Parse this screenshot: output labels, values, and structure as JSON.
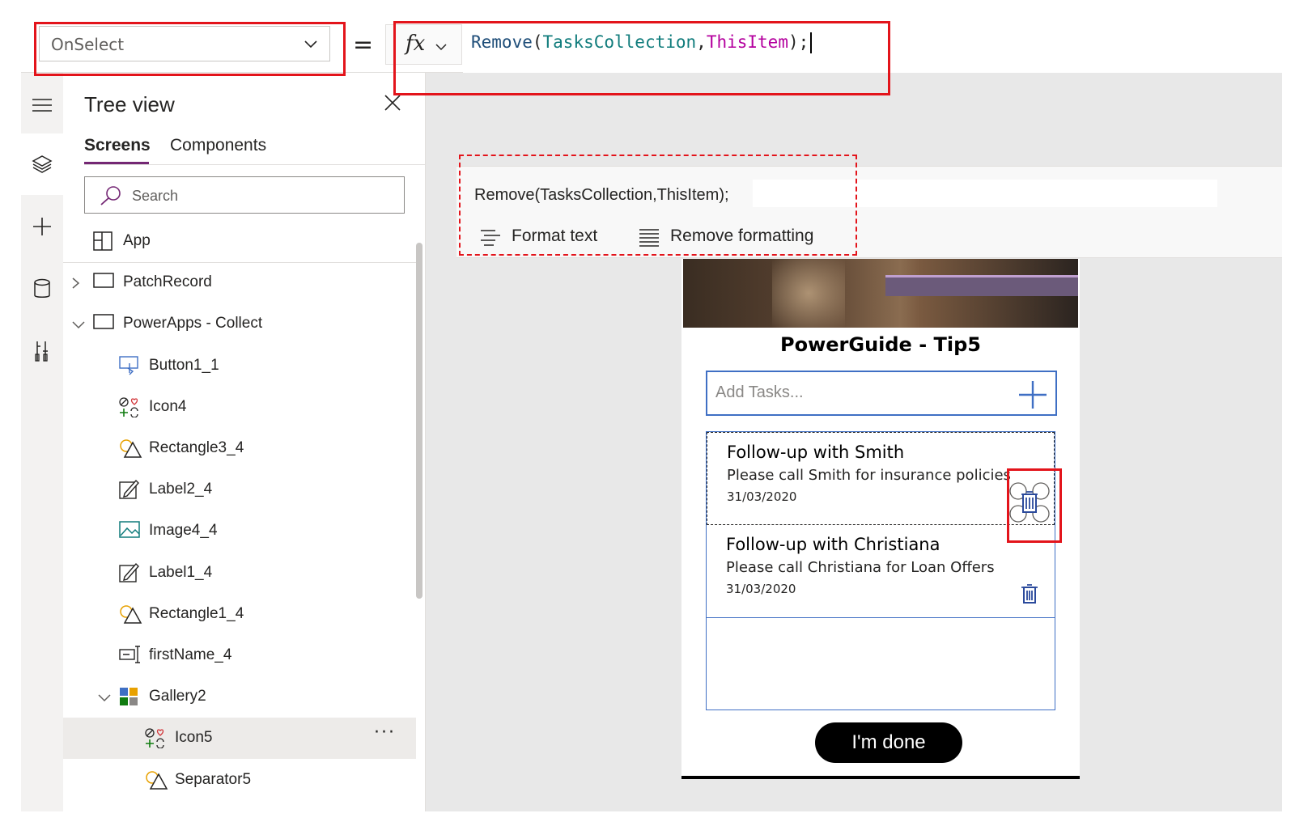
{
  "formula_bar": {
    "property": "OnSelect",
    "equals": "=",
    "fx_label": "fx",
    "formula_tokens": [
      {
        "text": "Remove",
        "kind": "fn"
      },
      {
        "text": "(",
        "kind": "pn"
      },
      {
        "text": "TasksCollection",
        "kind": "ds"
      },
      {
        "text": ",",
        "kind": "pn"
      },
      {
        "text": "ThisItem",
        "kind": "kw"
      },
      {
        "text": ");",
        "kind": "pn"
      }
    ]
  },
  "formula_strip": {
    "formula_text": "Remove(TasksCollection,ThisItem);",
    "format_text_label": "Format text",
    "remove_formatting_label": "Remove formatting"
  },
  "tree_view": {
    "title": "Tree view",
    "tabs": [
      "Screens",
      "Components"
    ],
    "search_placeholder": "Search",
    "items": [
      {
        "label": "App",
        "icon": "app-icon",
        "expander": "",
        "indent": 0
      },
      {
        "label": "PatchRecord",
        "icon": "screen-icon",
        "expander": "collapsed",
        "indent": 0
      },
      {
        "label": "PowerApps - Collect",
        "icon": "screen-icon",
        "expander": "expanded",
        "indent": 0
      },
      {
        "label": "Button1_1",
        "icon": "button-icon",
        "expander": "",
        "indent": 1
      },
      {
        "label": "Icon4",
        "icon": "icons-control-icon",
        "expander": "",
        "indent": 1
      },
      {
        "label": "Rectangle3_4",
        "icon": "shapes-icon",
        "expander": "",
        "indent": 1
      },
      {
        "label": "Label2_4",
        "icon": "label-icon",
        "expander": "",
        "indent": 1
      },
      {
        "label": "Image4_4",
        "icon": "image-icon",
        "expander": "",
        "indent": 1
      },
      {
        "label": "Label1_4",
        "icon": "label-icon",
        "expander": "",
        "indent": 1
      },
      {
        "label": "Rectangle1_4",
        "icon": "shapes-icon",
        "expander": "",
        "indent": 1
      },
      {
        "label": "firstName_4",
        "icon": "text-input-icon",
        "expander": "",
        "indent": 1
      },
      {
        "label": "Gallery2",
        "icon": "gallery-icon",
        "expander": "expanded",
        "indent": 1
      },
      {
        "label": "Icon5",
        "icon": "icons-control-icon",
        "expander": "",
        "indent": 2,
        "selected": true,
        "more": "···"
      },
      {
        "label": "Separator5",
        "icon": "shapes-icon",
        "expander": "",
        "indent": 2
      }
    ]
  },
  "app": {
    "title": "PowerGuide - Tip5",
    "add_task_placeholder": "Add Tasks...",
    "tasks": [
      {
        "title": "Follow-up with Smith",
        "description": "Please call Smith for insurance policies",
        "date": "31/03/2020"
      },
      {
        "title": "Follow-up with Christiana",
        "description": "Please call Christiana for Loan Offers",
        "date": "31/03/2020"
      }
    ],
    "done_label": "I'm done"
  },
  "colors": {
    "highlight": "#e3141b",
    "accent": "#742774",
    "app_border": "#3f6fc4"
  }
}
